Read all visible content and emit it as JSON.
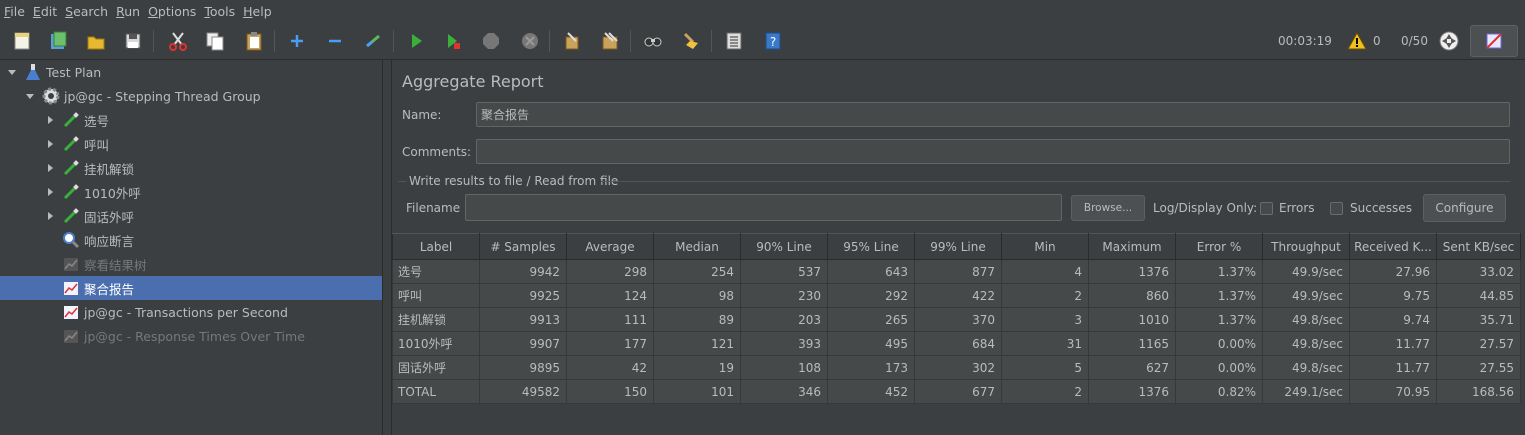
{
  "menu": [
    {
      "u": "F",
      "rest": "ile"
    },
    {
      "u": "E",
      "rest": "dit"
    },
    {
      "u": "S",
      "rest": "earch"
    },
    {
      "u": "R",
      "rest": "un"
    },
    {
      "u": "O",
      "rest": "ptions"
    },
    {
      "u": "T",
      "rest": "ools"
    },
    {
      "u": "H",
      "rest": "elp"
    }
  ],
  "toolbar": {
    "elapsed": "00:03:19",
    "warnings": "0",
    "threads": "0/50"
  },
  "tree": [
    {
      "label": "Test Plan",
      "icon": "flask-icon",
      "indent": 0,
      "caret": "down"
    },
    {
      "label": "jp@gc - Stepping Thread Group",
      "icon": "gear-icon",
      "indent": 1,
      "caret": "down"
    },
    {
      "label": "选号",
      "icon": "pipette-icon",
      "indent": 2,
      "caret": "right"
    },
    {
      "label": "呼叫",
      "icon": "pipette-icon",
      "indent": 2,
      "caret": "right"
    },
    {
      "label": "挂机解锁",
      "icon": "pipette-icon",
      "indent": 2,
      "caret": "right"
    },
    {
      "label": "1010外呼",
      "icon": "pipette-icon",
      "indent": 2,
      "caret": "right"
    },
    {
      "label": "固话外呼",
      "icon": "pipette-icon",
      "indent": 2,
      "caret": "right"
    },
    {
      "label": "响应断言",
      "icon": "magnifier-icon",
      "indent": 2,
      "caret": "none"
    },
    {
      "label": "察看结果树",
      "icon": "chart-icon",
      "indent": 2,
      "caret": "none",
      "disabled": true
    },
    {
      "label": "聚合报告",
      "icon": "chart-icon",
      "indent": 2,
      "caret": "none",
      "selected": true
    },
    {
      "label": "jp@gc - Transactions per Second",
      "icon": "chart-icon",
      "indent": 2,
      "caret": "none"
    },
    {
      "label": "jp@gc - Response Times Over Time",
      "icon": "chart-icon",
      "indent": 2,
      "caret": "none",
      "disabled": true
    }
  ],
  "panel": {
    "title": "Aggregate Report",
    "name_label": "Name:",
    "name_value": "聚合报告",
    "comments_label": "Comments:",
    "comments_value": "",
    "group_title": "Write results to file / Read from file",
    "filename_label": "Filename",
    "filename_value": "",
    "browse_label": "Browse...",
    "log_display_label": "Log/Display Only:",
    "errors_label": "Errors",
    "successes_label": "Successes",
    "configure_label": "Configure"
  },
  "table": {
    "headers": [
      "Label",
      "# Samples",
      "Average",
      "Median",
      "90% Line",
      "95% Line",
      "99% Line",
      "Min",
      "Maximum",
      "Error %",
      "Throughput",
      "Received K...",
      "Sent KB/sec"
    ],
    "rows": [
      [
        "选号",
        "9942",
        "298",
        "254",
        "537",
        "643",
        "877",
        "4",
        "1376",
        "1.37%",
        "49.9/sec",
        "27.96",
        "33.02"
      ],
      [
        "呼叫",
        "9925",
        "124",
        "98",
        "230",
        "292",
        "422",
        "2",
        "860",
        "1.37%",
        "49.9/sec",
        "9.75",
        "44.85"
      ],
      [
        "挂机解锁",
        "9913",
        "111",
        "89",
        "203",
        "265",
        "370",
        "3",
        "1010",
        "1.37%",
        "49.8/sec",
        "9.74",
        "35.71"
      ],
      [
        "1010外呼",
        "9907",
        "177",
        "121",
        "393",
        "495",
        "684",
        "31",
        "1165",
        "0.00%",
        "49.8/sec",
        "11.77",
        "27.57"
      ],
      [
        "固话外呼",
        "9895",
        "42",
        "19",
        "108",
        "173",
        "302",
        "5",
        "627",
        "0.00%",
        "49.8/sec",
        "11.77",
        "27.55"
      ],
      [
        "TOTAL",
        "49582",
        "150",
        "101",
        "346",
        "452",
        "677",
        "2",
        "1376",
        "0.82%",
        "249.1/sec",
        "70.95",
        "168.56"
      ]
    ]
  }
}
